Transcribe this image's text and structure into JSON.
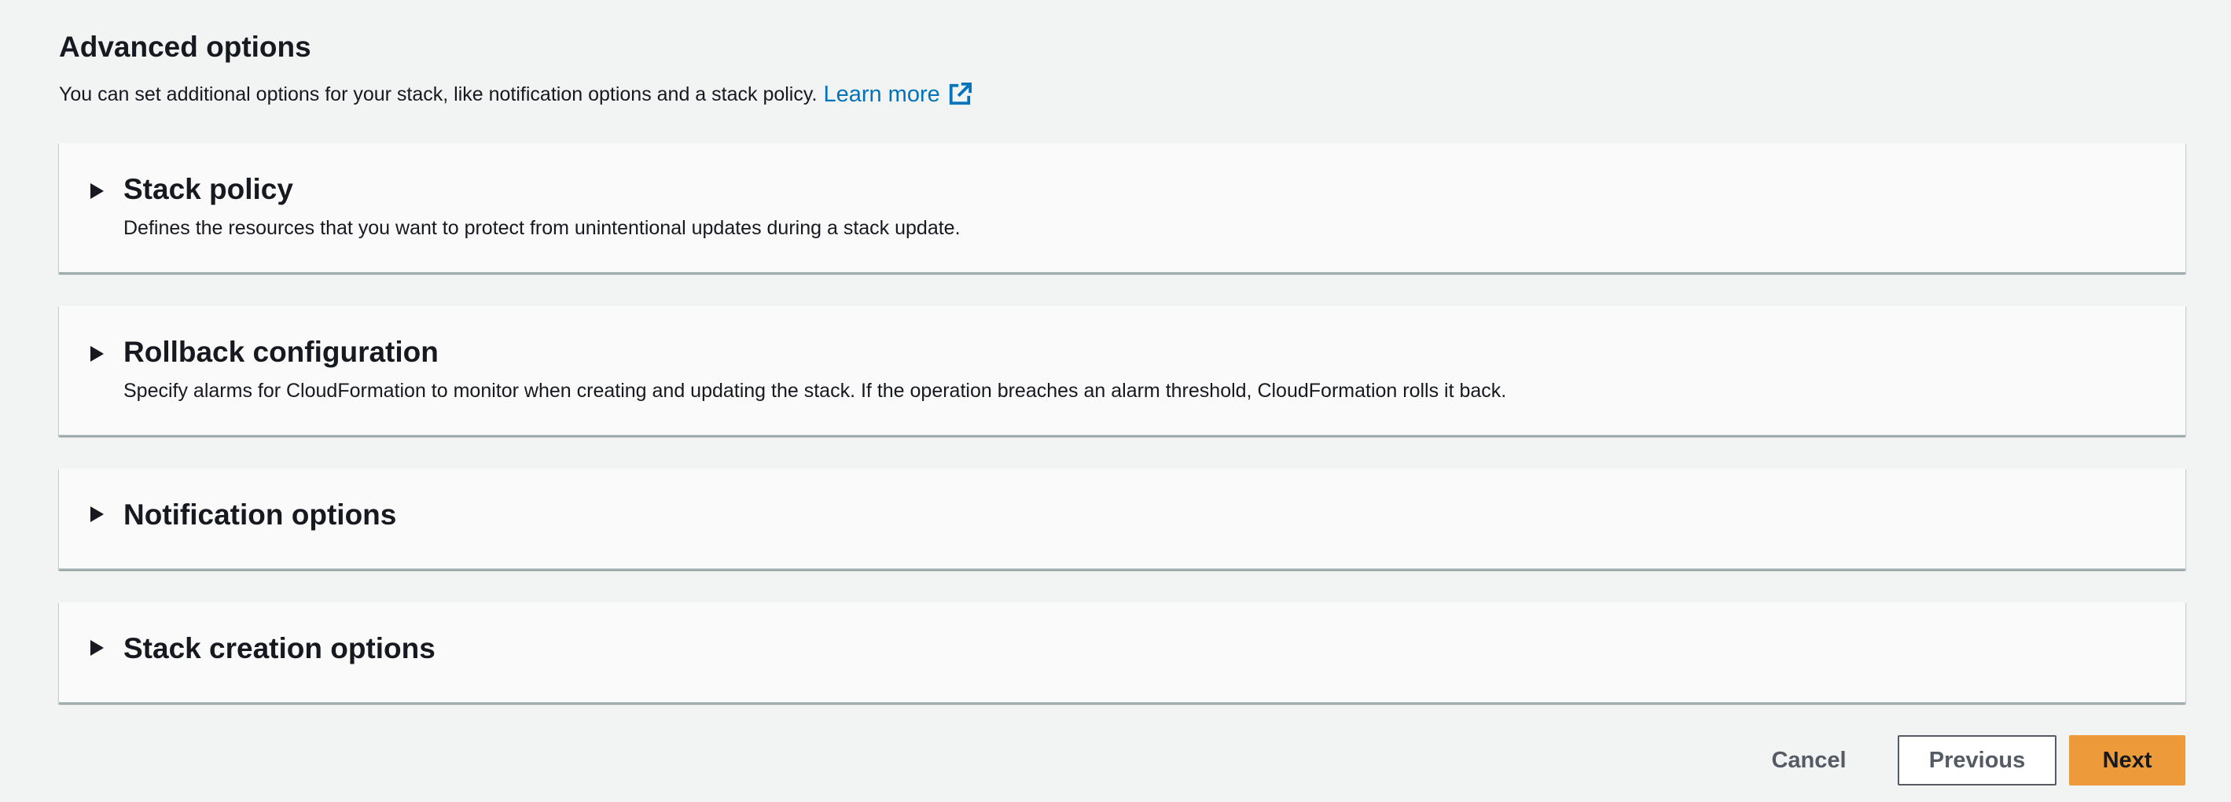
{
  "section": {
    "title": "Advanced options",
    "description": "You can set additional options for your stack, like notification options and a stack policy.",
    "learn_more": "Learn more"
  },
  "panels": [
    {
      "title": "Stack policy",
      "description": "Defines the resources that you want to protect from unintentional updates during a stack update."
    },
    {
      "title": "Rollback configuration",
      "description": "Specify alarms for CloudFormation to monitor when creating and updating the stack. If the operation breaches an alarm threshold, CloudFormation rolls it back."
    },
    {
      "title": "Notification options"
    },
    {
      "title": "Stack creation options"
    }
  ],
  "actions": {
    "cancel": "Cancel",
    "previous": "Previous",
    "next": "Next"
  },
  "colors": {
    "link": "#0073bb",
    "primary_button": "#ec9a3a",
    "background": "#f2f3f3"
  },
  "icons": {
    "external_link": "external-link-icon",
    "caret": "caret-right-icon"
  }
}
